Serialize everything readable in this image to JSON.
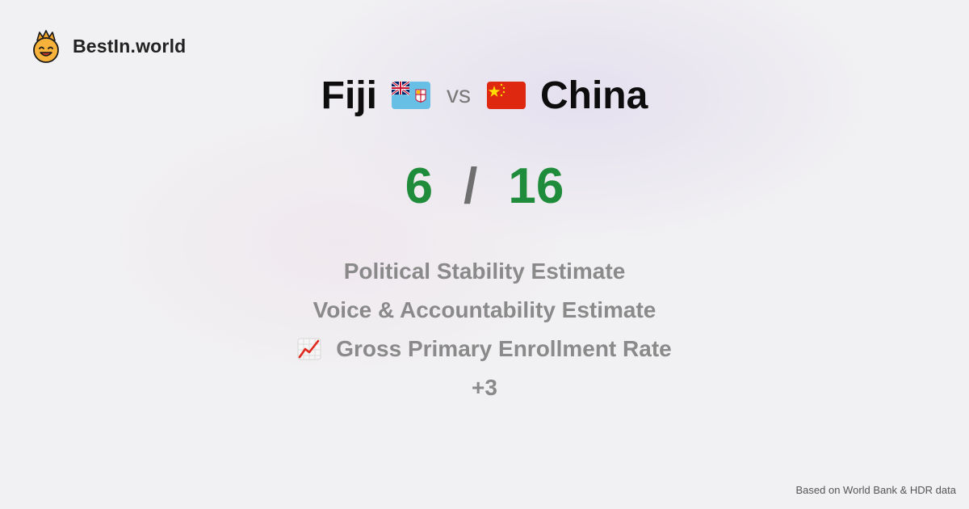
{
  "brand": {
    "name": "BestIn.world",
    "logo_icon": "crown-smiley-icon"
  },
  "comparison": {
    "country_a": "Fiji",
    "flag_a_icon": "fiji-flag-icon",
    "vs_label": "vs",
    "country_b": "China",
    "flag_b_icon": "china-flag-icon"
  },
  "score": {
    "a": "6",
    "separator": "/",
    "b": "16",
    "color": "#1e8c3a"
  },
  "metrics": [
    {
      "label": "Political Stability Estimate"
    },
    {
      "label": "Voice & Accountability Estimate"
    },
    {
      "label": "Gross Primary Enrollment Rate",
      "icon": "chart-increasing-icon"
    },
    {
      "label": "+3"
    }
  ],
  "footer": {
    "source": "Based on World Bank & HDR data"
  }
}
